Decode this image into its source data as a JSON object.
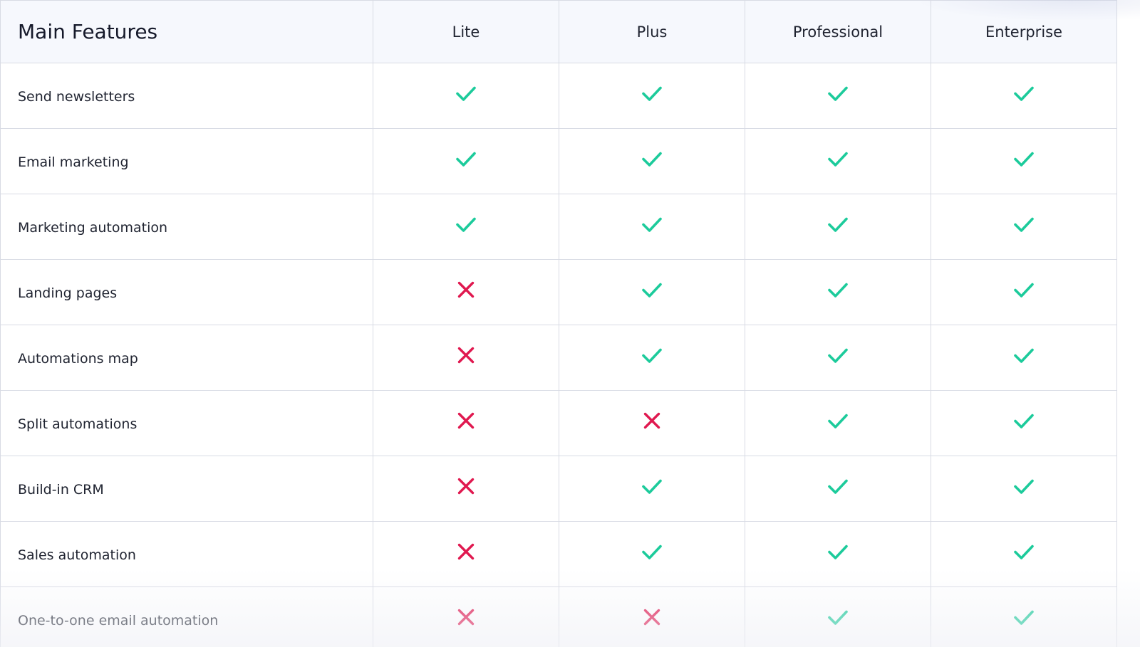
{
  "table": {
    "header": {
      "feature_title": "Main Features",
      "plans": [
        "Lite",
        "Plus",
        "Professional",
        "Enterprise"
      ]
    },
    "colors": {
      "check": "#1ccb9b",
      "cross": "#e0184f",
      "border": "#d8dbe4",
      "header_bg": "#f6f8fd"
    },
    "rows": [
      {
        "feature": "Send newsletters",
        "availability": [
          "check",
          "check",
          "check",
          "check"
        ]
      },
      {
        "feature": "Email marketing",
        "availability": [
          "check",
          "check",
          "check",
          "check"
        ]
      },
      {
        "feature": "Marketing automation",
        "availability": [
          "check",
          "check",
          "check",
          "check"
        ]
      },
      {
        "feature": "Landing pages",
        "availability": [
          "cross",
          "check",
          "check",
          "check"
        ]
      },
      {
        "feature": "Automations map",
        "availability": [
          "cross",
          "check",
          "check",
          "check"
        ]
      },
      {
        "feature": "Split automations",
        "availability": [
          "cross",
          "cross",
          "check",
          "check"
        ]
      },
      {
        "feature": "Build-in CRM",
        "availability": [
          "cross",
          "check",
          "check",
          "check"
        ]
      },
      {
        "feature": "Sales automation",
        "availability": [
          "cross",
          "check",
          "check",
          "check"
        ]
      },
      {
        "feature": "One-to-one email automation",
        "availability": [
          "cross",
          "cross",
          "check",
          "check"
        ]
      }
    ]
  }
}
